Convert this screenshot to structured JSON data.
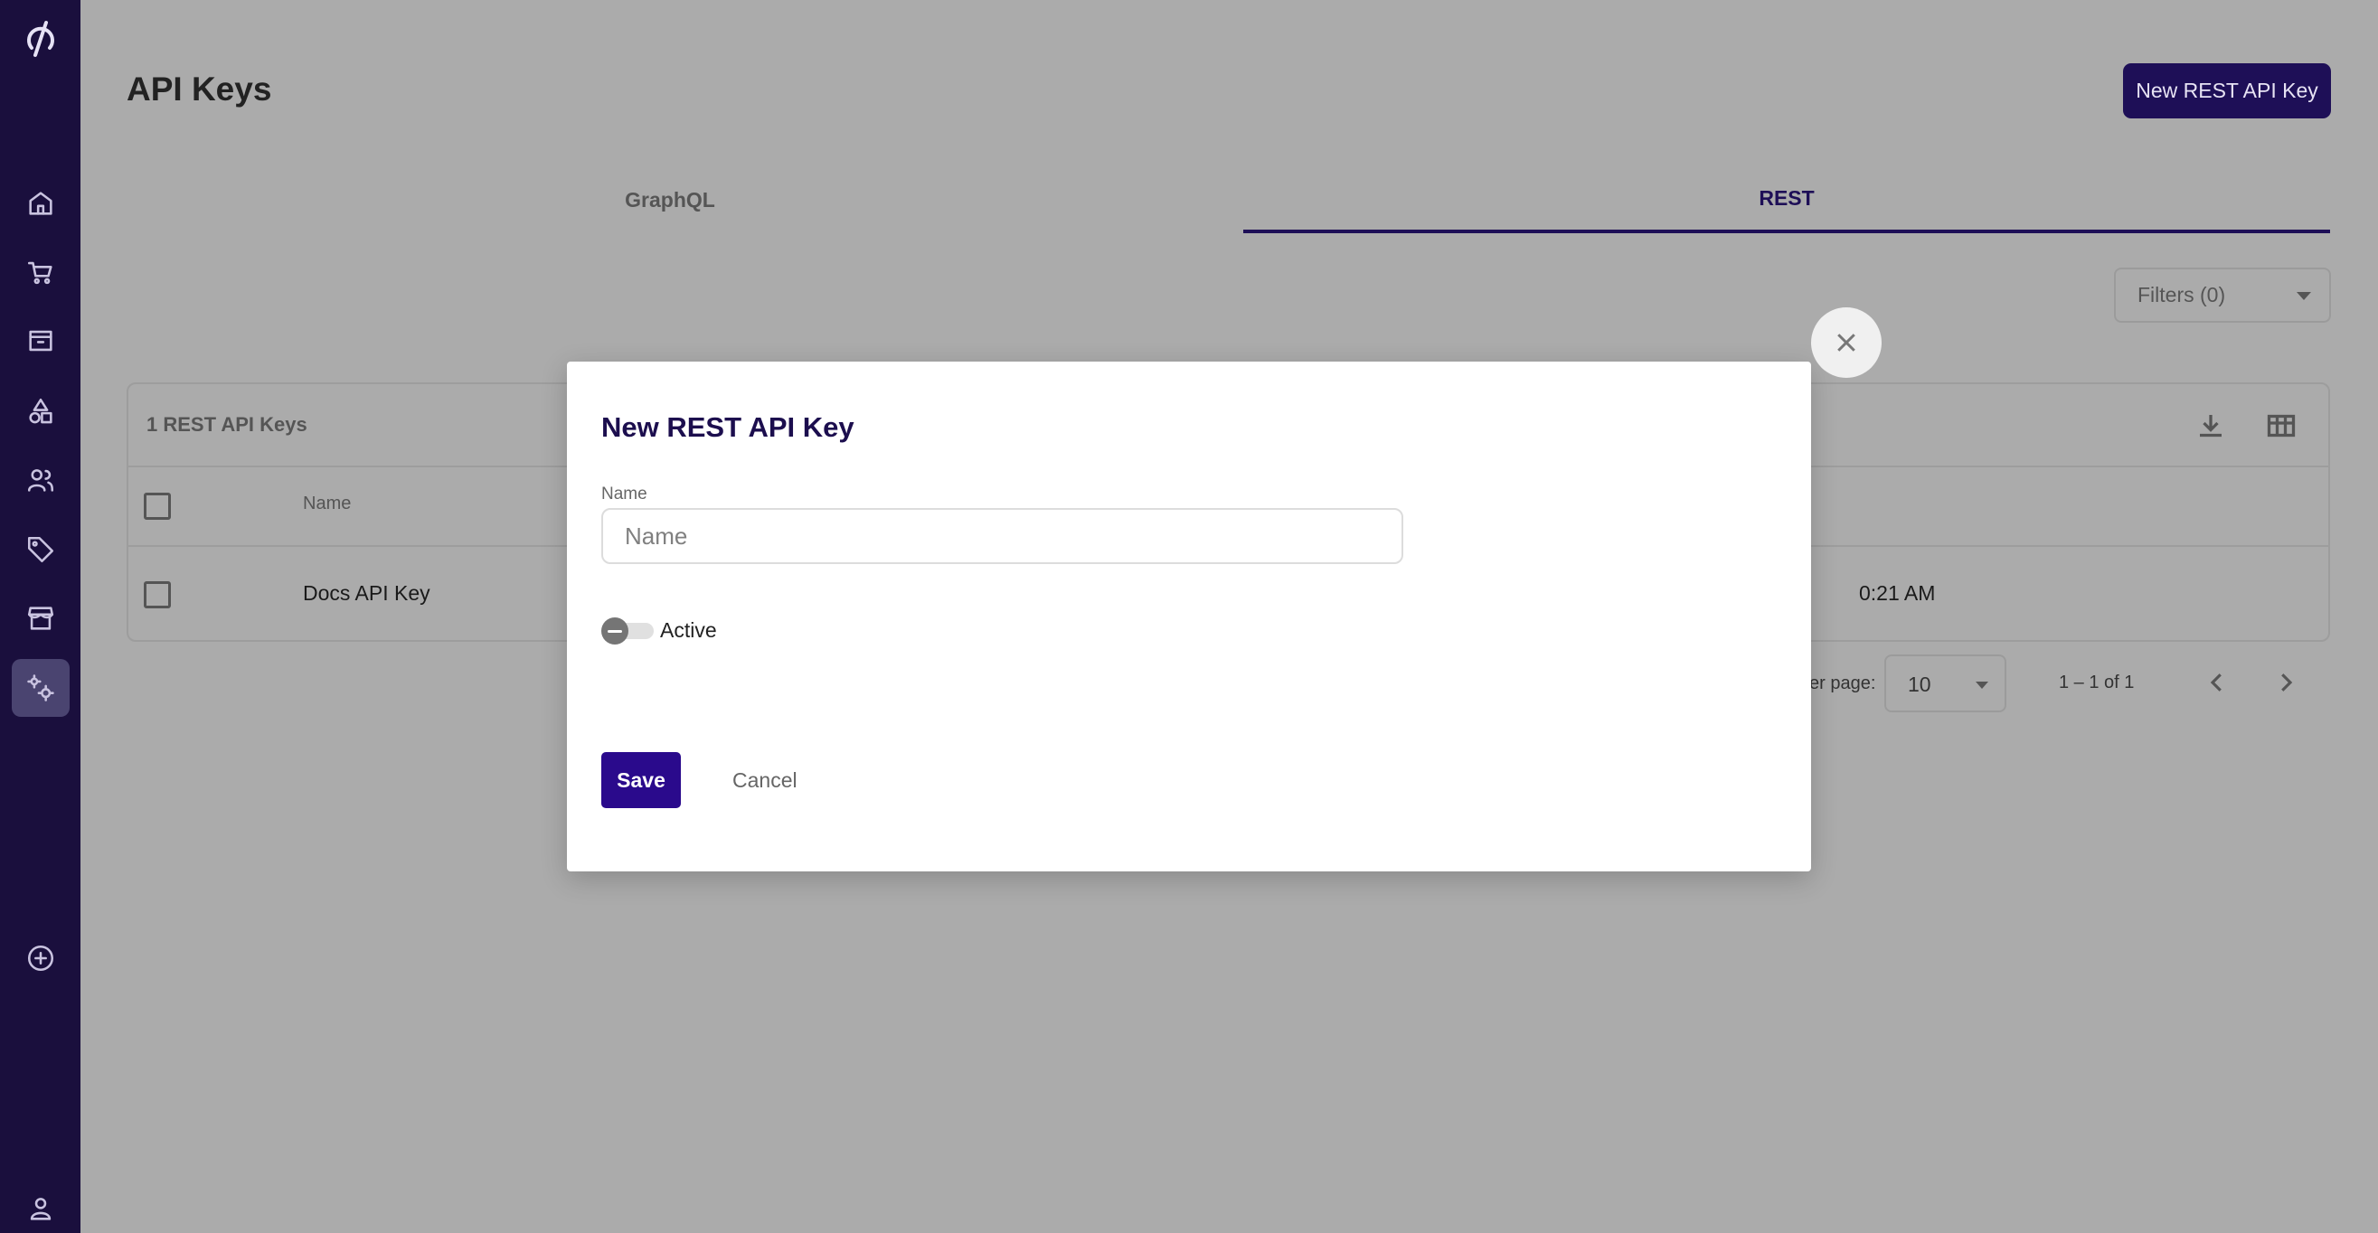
{
  "page": {
    "title": "API Keys"
  },
  "header": {
    "new_key_button": "New REST API Key"
  },
  "tabs": [
    {
      "label": "GraphQL",
      "active": false
    },
    {
      "label": "REST",
      "active": true
    }
  ],
  "filters": {
    "label": "Filters (0)"
  },
  "table": {
    "title": "1 REST API Keys",
    "columns": [
      "Name"
    ],
    "rows": [
      {
        "name": "Docs API Key",
        "date_fragment": "0:21 AM"
      }
    ]
  },
  "pagination": {
    "rows_label_fragment": "er page:",
    "rows_per_page": "10",
    "range": "1 – 1 of 1"
  },
  "sidebar": {
    "icons": [
      "logo-icon",
      "home-icon",
      "cart-icon",
      "store-icon",
      "shapes-icon",
      "users-icon",
      "tag-icon",
      "storefront-icon",
      "settings-icon",
      "add-circle-icon",
      "profile-icon"
    ]
  },
  "modal": {
    "title": "New REST API Key",
    "name_label": "Name",
    "name_placeholder": "Name",
    "name_value": "",
    "active_label": "Active",
    "active_checked": false,
    "save_label": "Save",
    "cancel_label": "Cancel"
  },
  "colors": {
    "brand_primary": "#2a0a8c",
    "sidebar_bg": "#1a0f3d",
    "overlay_bg": "#ababab"
  }
}
